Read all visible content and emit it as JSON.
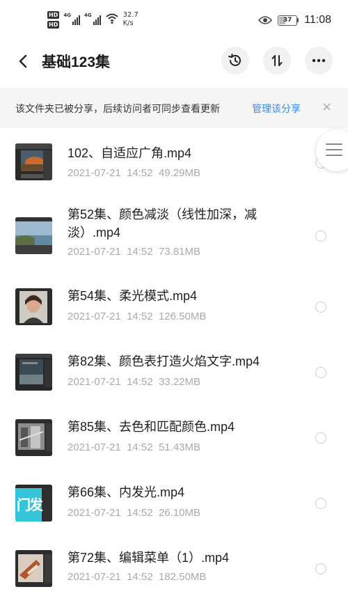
{
  "status_bar": {
    "hd1": "HD",
    "hd2": "HD",
    "sig1": "4G",
    "sig2": "4G",
    "speed_value": "32.7",
    "speed_unit": "K/s",
    "battery": "37",
    "time": "11:08",
    "icons": [
      "hd-icon",
      "signal-icon",
      "wifi-icon",
      "eye-icon",
      "battery-icon"
    ]
  },
  "header": {
    "title": "基础123集",
    "icons": [
      "back-icon",
      "history-icon",
      "sort-icon",
      "more-icon"
    ]
  },
  "notice": {
    "text": "该文件夹已被分享，后续访问者可同步查看更新",
    "link": "管理该分享",
    "close": "×",
    "link_color": "#3a8ae0"
  },
  "files": [
    {
      "name": "102、自适应广角.mp4",
      "date": "2021-07-21",
      "time": "14:52",
      "size": "49.29MB",
      "thumb": "photoshop-screenshot-thumbnail"
    },
    {
      "name": "第52集、颜色减淡（线性加深，减淡）.mp4",
      "date": "2021-07-21",
      "time": "14:52",
      "size": "73.81MB",
      "thumb": "coastal-landscape-thumbnail"
    },
    {
      "name": "第54集、柔光模式.mp4",
      "date": "2021-07-21",
      "time": "14:52",
      "size": "126.50MB",
      "thumb": "portrait-thumbnail"
    },
    {
      "name": "第82集、颜色表打造火焰文字.mp4",
      "date": "2021-07-21",
      "time": "14:52",
      "size": "33.22MB",
      "thumb": "editor-screenshot-thumbnail"
    },
    {
      "name": "第85集、去色和匹配颜色.mp4",
      "date": "2021-07-21",
      "time": "14:52",
      "size": "51.43MB",
      "thumb": "grayscale-photo-thumbnail"
    },
    {
      "name": "第66集、内发光.mp4",
      "date": "2021-07-21",
      "time": "14:52",
      "size": "26.10MB",
      "thumb_text": "门发",
      "thumb": "text-effect-thumbnail"
    },
    {
      "name": "第72集、编辑菜单（1）.mp4",
      "date": "2021-07-21",
      "time": "14:52",
      "size": "182.50MB",
      "thumb": "product-photo-thumbnail"
    }
  ]
}
